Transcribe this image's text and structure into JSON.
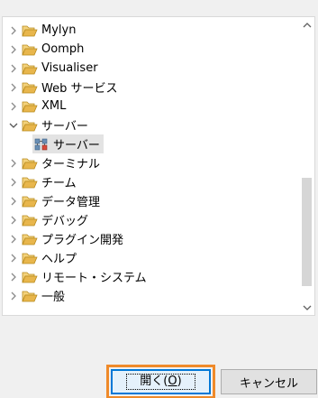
{
  "tree": {
    "items": [
      {
        "label": "Mylyn",
        "expanded": false
      },
      {
        "label": "Oomph",
        "expanded": false
      },
      {
        "label": "Visualiser",
        "expanded": false
      },
      {
        "label": "Web サービス",
        "expanded": false
      },
      {
        "label": "XML",
        "expanded": false
      },
      {
        "label": "サーバー",
        "expanded": true,
        "children": [
          {
            "label": "サーバー",
            "selected": true
          }
        ]
      },
      {
        "label": "ターミナル",
        "expanded": false
      },
      {
        "label": "チーム",
        "expanded": false
      },
      {
        "label": "データ管理",
        "expanded": false
      },
      {
        "label": "デバッグ",
        "expanded": false
      },
      {
        "label": "プラグイン開発",
        "expanded": false
      },
      {
        "label": "ヘルプ",
        "expanded": false
      },
      {
        "label": "リモート・システム",
        "expanded": false
      },
      {
        "label": "一般",
        "expanded": false
      }
    ]
  },
  "buttons": {
    "open": {
      "label_prefix": "開く(",
      "mnemonic": "O",
      "label_suffix": ")"
    },
    "cancel": {
      "label": "キャンセル"
    }
  },
  "colors": {
    "folder": "#e8b64c",
    "focus_highlight": "#ef8a2a",
    "default_button_border": "#0078d7",
    "scroll_thumb": "#d6d6d6"
  },
  "icons": {
    "collapsed": "chevron-right-icon",
    "expanded": "chevron-down-icon",
    "folder": "folder-open-icon",
    "server": "server-icon"
  }
}
